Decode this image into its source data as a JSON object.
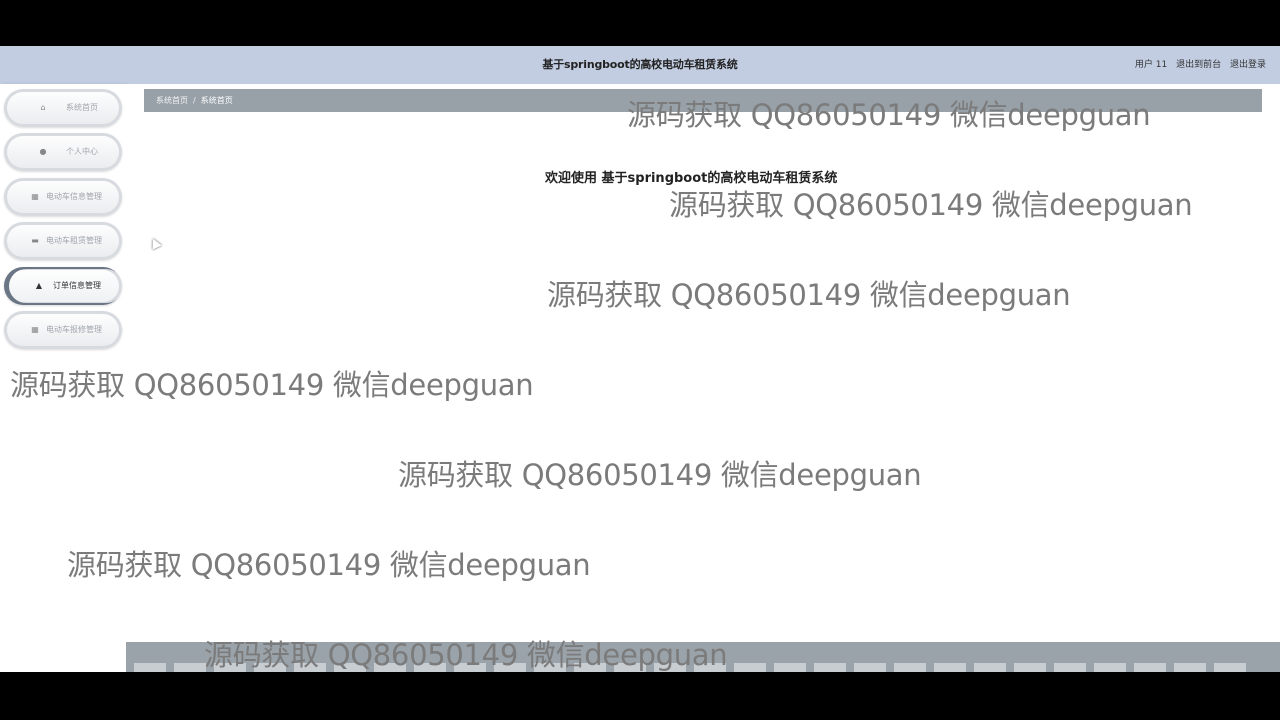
{
  "app": {
    "title": "基于springboot的高校电动车租赁系统"
  },
  "topbar": {
    "user_label": "用户 11",
    "exit_front_label": "退出到前台",
    "logout_label": "退出登录"
  },
  "sidebar": {
    "items": [
      {
        "label": "系统首页",
        "icon": "home-icon",
        "active": false
      },
      {
        "label": "个人中心",
        "icon": "user-icon",
        "active": false
      },
      {
        "label": "电动车信息管理",
        "icon": "grid-icon",
        "active": false
      },
      {
        "label": "电动车租赁管理",
        "icon": "chat-icon",
        "active": false
      },
      {
        "label": "订单信息管理",
        "icon": "user-upload-icon",
        "active": true
      },
      {
        "label": "电动车报修管理",
        "icon": "grid-icon",
        "active": false
      }
    ]
  },
  "breadcrumb": {
    "home": "系统首页",
    "separator": "/",
    "current": "系统首页"
  },
  "main": {
    "welcome": "欢迎使用 基于springboot的高校电动车租赁系统"
  },
  "watermark": {
    "text": "源码获取 QQ86050149 微信deepguan"
  },
  "colors": {
    "topbar": "#c2cde2",
    "breadcrumb": "#98a1a8",
    "bottom_strip": "#9ba3aa",
    "watermark": "#7b7b7b"
  }
}
